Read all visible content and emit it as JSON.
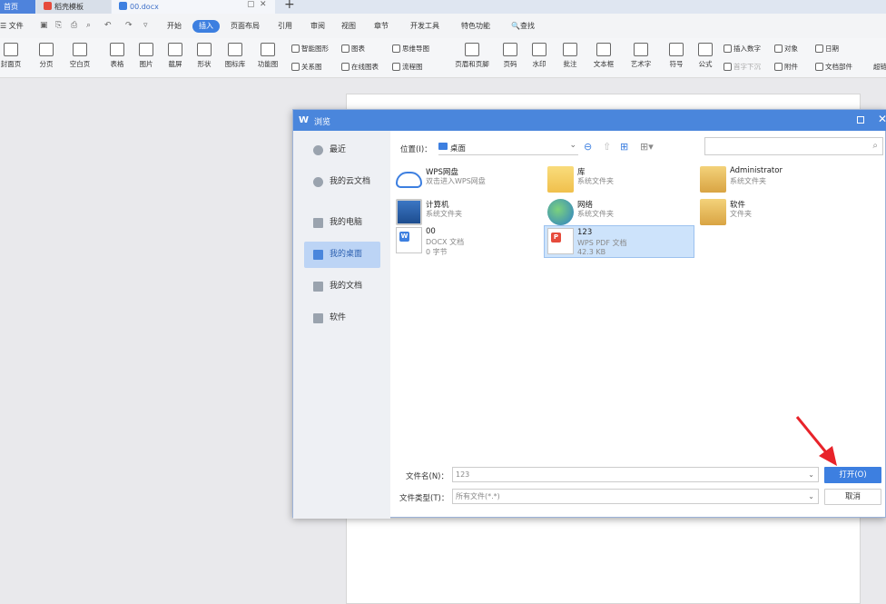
{
  "tabs": {
    "home": "首页",
    "template": "稻壳模板",
    "document": "00.docx"
  },
  "menu": {
    "file": "文件",
    "items": [
      "开始",
      "插入",
      "页面布局",
      "引用",
      "审阅",
      "视图",
      "章节",
      "开发工具",
      "特色功能",
      "查找"
    ],
    "active": "插入"
  },
  "ribbon": {
    "large": [
      "封面页",
      "分页",
      "空白页",
      "表格",
      "图片",
      "截屏",
      "形状",
      "图标库",
      "功能图",
      "页眉和页脚",
      "页码",
      "水印",
      "批注",
      "文本框",
      "艺术字",
      "符号",
      "公式",
      "文档部件"
    ],
    "small": {
      "smartart": "智能图形",
      "chart": "图表",
      "relation": "关系图",
      "online_chart": "在线图表",
      "mindmap": "思维导图",
      "flowchart": "流程图",
      "insert_number": "插入数字",
      "dropcap": "首字下沉",
      "object": "对象",
      "attachment": "附件",
      "date": "日期",
      "extra": "超链"
    }
  },
  "dialog": {
    "title": "浏览",
    "sidebar": [
      "最近",
      "我的云文档",
      "我的电脑",
      "我的桌面",
      "我的文档",
      "软件"
    ],
    "sidebar_active_index": 3,
    "location_label": "位置(I)：",
    "location_value": "桌面",
    "files": [
      {
        "name": "WPS网盘",
        "sub": "双击进入WPS网盘",
        "sub2": ""
      },
      {
        "name": "库",
        "sub": "系统文件夹",
        "sub2": ""
      },
      {
        "name": "Administrator",
        "sub": "系统文件夹",
        "sub2": ""
      },
      {
        "name": "计算机",
        "sub": "系统文件夹",
        "sub2": ""
      },
      {
        "name": "网络",
        "sub": "系统文件夹",
        "sub2": ""
      },
      {
        "name": "软件",
        "sub": "文件夹",
        "sub2": ""
      },
      {
        "name": "00",
        "sub": "DOCX 文档",
        "sub2": "0 字节"
      },
      {
        "name": "123",
        "sub": "WPS PDF 文档",
        "sub2": "42.3 KB"
      }
    ],
    "filename_label": "文件名(N)：",
    "filename_value": "123",
    "filetype_label": "文件类型(T)：",
    "filetype_value": "所有文件(*.*)",
    "open_button": "打开(O)",
    "cancel_button": "取消"
  },
  "colors": {
    "accent": "#3d7fe0",
    "title_bar": "#4a86dc",
    "arrow": "#e8232a"
  }
}
